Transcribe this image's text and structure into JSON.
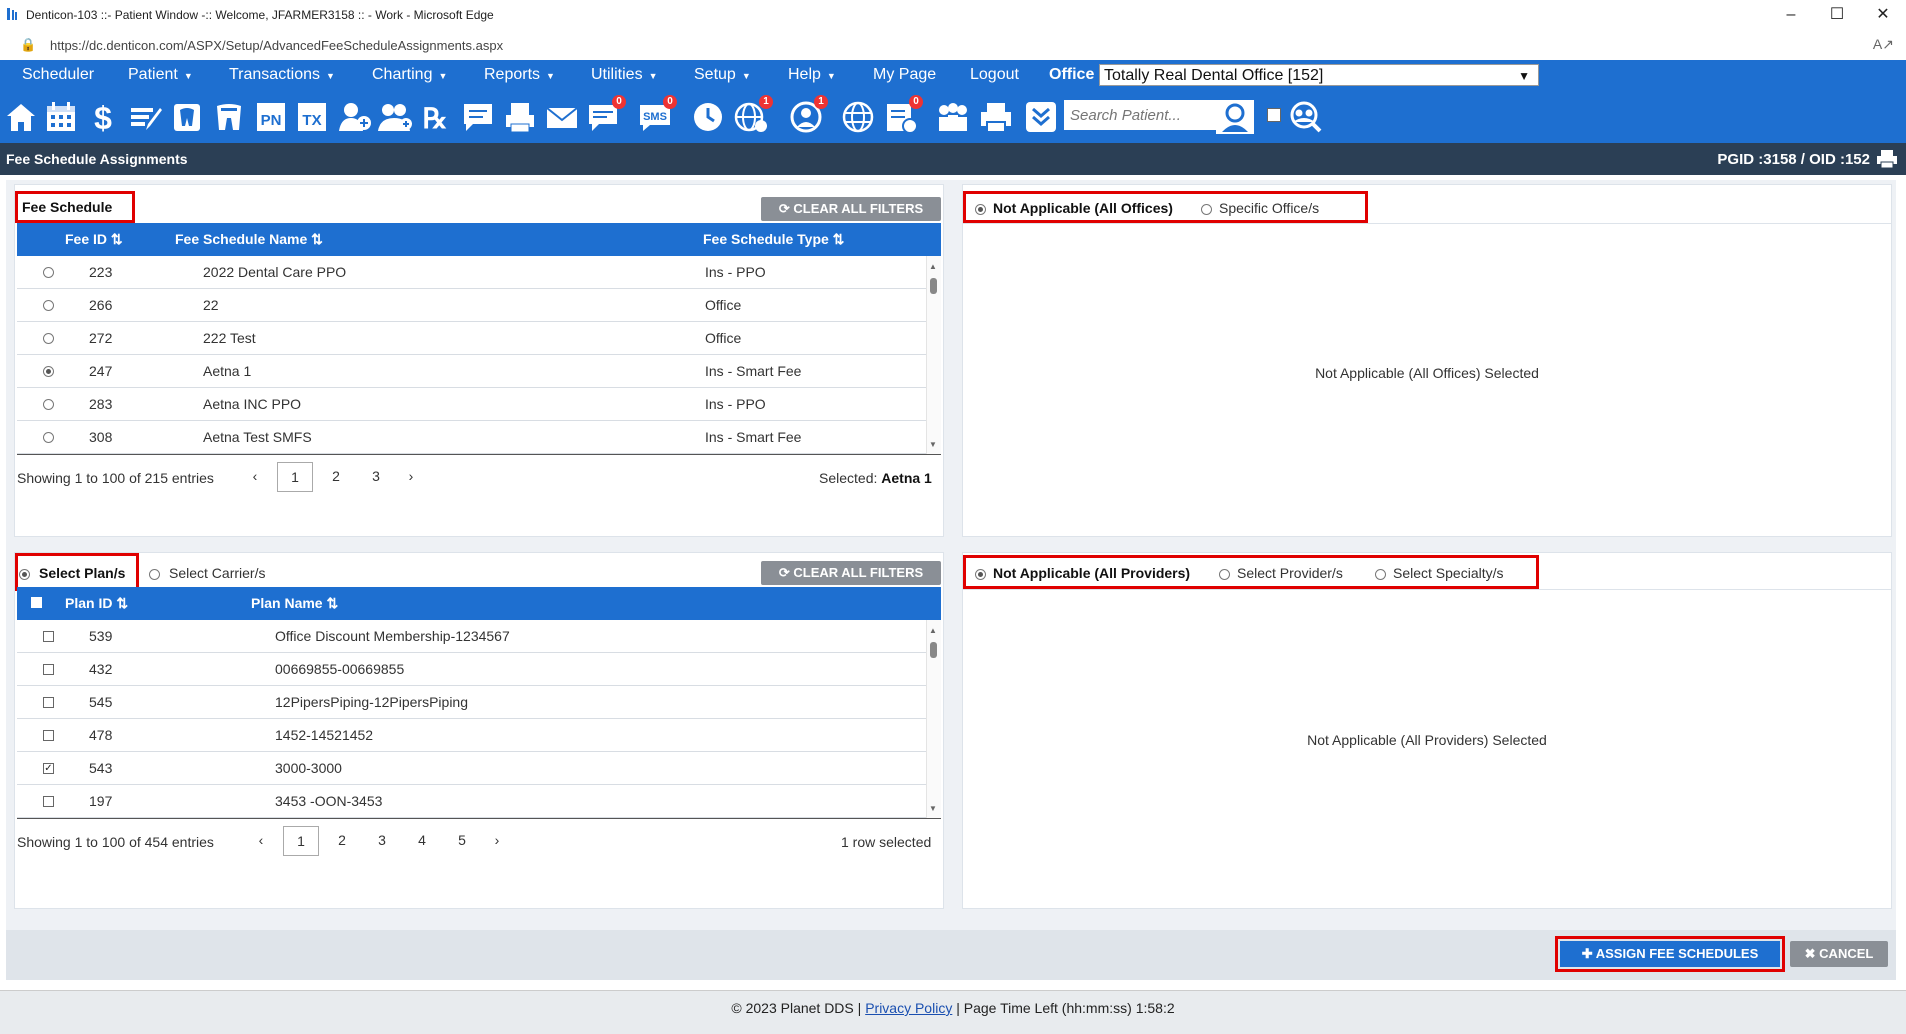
{
  "window": {
    "title": "Denticon-103 ::- Patient Window -:: Welcome, JFARMER3158 :: - Work - Microsoft Edge",
    "url": "https://dc.denticon.com/ASPX/Setup/AdvancedFeeScheduleAssignments.aspx"
  },
  "menu": {
    "items": [
      {
        "label": "Scheduler"
      },
      {
        "label": "Patient",
        "caret": "▼"
      },
      {
        "label": "Transactions",
        "caret": "▼"
      },
      {
        "label": "Charting",
        "caret": "▼"
      },
      {
        "label": "Reports",
        "caret": "▼"
      },
      {
        "label": "Utilities",
        "caret": "▼"
      },
      {
        "label": "Setup",
        "caret": "▼"
      },
      {
        "label": "Help",
        "caret": "▼"
      },
      {
        "label": "My Page"
      },
      {
        "label": "Logout"
      }
    ],
    "office_label": "Office",
    "office_value": "Totally Real Dental Office [152]"
  },
  "toolbar": {
    "search_placeholder": "Search Patient...",
    "badges": {
      "msg": "0",
      "web": "1",
      "sms": "0",
      "person": "1",
      "doc": "0"
    },
    "pn": "PN",
    "tx": "TX"
  },
  "page": {
    "title": "Fee Schedule Assignments",
    "ids": "PGID :3158  /  OID :152"
  },
  "fee_schedule": {
    "label": "Fee Schedule",
    "clear_filters": "CLEAR ALL FILTERS",
    "columns": [
      "Fee ID",
      "Fee Schedule Name",
      "Fee Schedule Type"
    ],
    "rows": [
      {
        "id": "223",
        "name": "2022 Dental Care PPO",
        "type": "Ins - PPO",
        "selected": false
      },
      {
        "id": "266",
        "name": "22",
        "type": "Office",
        "selected": false
      },
      {
        "id": "272",
        "name": "222 Test",
        "type": "Office",
        "selected": false
      },
      {
        "id": "247",
        "name": "Aetna 1",
        "type": "Ins - Smart Fee",
        "selected": true
      },
      {
        "id": "283",
        "name": "Aetna INC PPO",
        "type": "Ins - PPO",
        "selected": false
      },
      {
        "id": "308",
        "name": "Aetna Test SMFS",
        "type": "Ins - Smart Fee",
        "selected": false
      }
    ],
    "showing": "Showing 1 to 100 of 215 entries",
    "pages": [
      "1",
      "2",
      "3"
    ],
    "prev": "‹",
    "next": "›",
    "selected_label": "Selected:",
    "selected_value": "Aetna 1"
  },
  "offices": {
    "opt_all": "Not Applicable (All Offices)",
    "opt_specific": "Specific Office/s",
    "message": "Not Applicable (All Offices) Selected"
  },
  "plans": {
    "opt_plans": "Select Plan/s",
    "opt_carriers": "Select Carrier/s",
    "clear_filters": "CLEAR ALL FILTERS",
    "columns": [
      "Plan ID",
      "Plan Name"
    ],
    "rows": [
      {
        "id": "539",
        "name": "Office Discount Membership-1234567",
        "checked": false
      },
      {
        "id": "432",
        "name": "00669855-00669855",
        "checked": false
      },
      {
        "id": "545",
        "name": "12PipersPiping-12PipersPiping",
        "checked": false
      },
      {
        "id": "478",
        "name": "1452-14521452",
        "checked": false
      },
      {
        "id": "543",
        "name": "3000-3000",
        "checked": true
      },
      {
        "id": "197",
        "name": "3453 -OON-3453",
        "checked": false
      }
    ],
    "showing": "Showing 1 to 100 of 454 entries",
    "pages": [
      "1",
      "2",
      "3",
      "4",
      "5"
    ],
    "prev": "‹",
    "next": "›",
    "selected_text": "1 row selected"
  },
  "providers": {
    "opt_all": "Not Applicable (All Providers)",
    "opt_provider": "Select Provider/s",
    "opt_specialty": "Select Specialty/s",
    "message": "Not Applicable (All Providers) Selected"
  },
  "actions": {
    "assign": "ASSIGN FEE SCHEDULES",
    "cancel": "CANCEL"
  },
  "footer": {
    "copyright": "© 2023 Planet DDS |",
    "privacy": "Privacy Policy",
    "time_left": "| Page Time Left (hh:mm:ss) 1:58:2"
  },
  "colors": {
    "accent": "#1e6fd0",
    "header": "#2b3f55",
    "highlight": "#e00000"
  }
}
